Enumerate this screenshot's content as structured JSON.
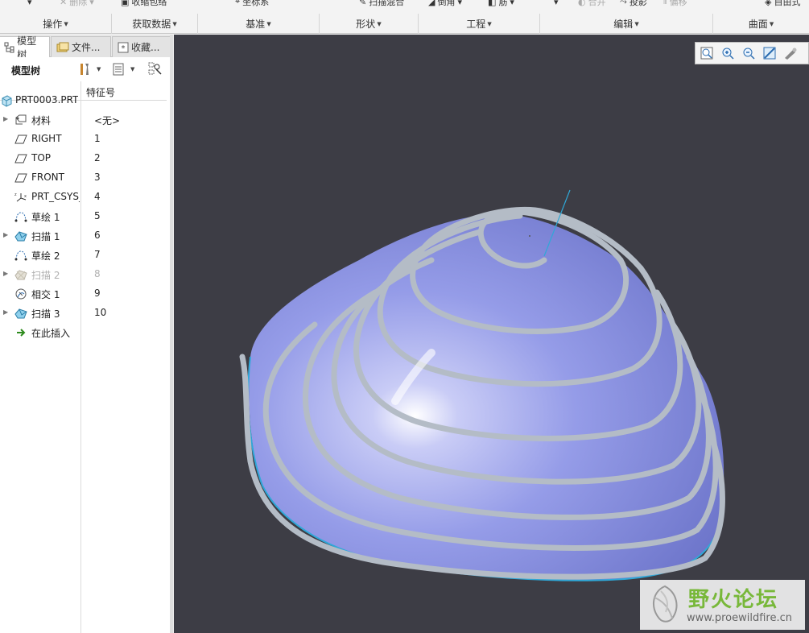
{
  "ribbon": {
    "top_items": [
      {
        "label": "删除",
        "dim": true
      },
      {
        "label": "收缩包络",
        "dim": false
      },
      {
        "label": "坐标系",
        "dim": false
      },
      {
        "label": "扫描混合",
        "dim": false
      },
      {
        "label": "倒角",
        "dim": false
      },
      {
        "label": "筋",
        "dim": false
      },
      {
        "label": "合并",
        "dim": true
      },
      {
        "label": "投影",
        "dim": false
      },
      {
        "label": "偏移",
        "dim": true
      },
      {
        "label": "自由式",
        "dim": false
      }
    ],
    "groups": [
      "操作",
      "获取数据",
      "基准",
      "形状",
      "工程",
      "编辑",
      "曲面"
    ]
  },
  "left_panel": {
    "tabs": [
      {
        "label": "模型树",
        "icon": "model-tree-icon"
      },
      {
        "label": "文件...",
        "icon": "folder-icon"
      },
      {
        "label": "收藏...",
        "icon": "favorites-icon"
      }
    ],
    "tree_title": "模型树",
    "column_header": "特征号",
    "root": "PRT0003.PRT",
    "rows": [
      {
        "label": "材料",
        "featno": "<无>",
        "icon": "material-icon",
        "expandable": true,
        "disabled": false
      },
      {
        "label": "RIGHT",
        "featno": "1",
        "icon": "datum-plane-icon",
        "expandable": false,
        "disabled": false
      },
      {
        "label": "TOP",
        "featno": "2",
        "icon": "datum-plane-icon",
        "expandable": false,
        "disabled": false
      },
      {
        "label": "FRONT",
        "featno": "3",
        "icon": "datum-plane-icon",
        "expandable": false,
        "disabled": false
      },
      {
        "label": "PRT_CSYS_",
        "featno": "4",
        "icon": "csys-icon",
        "expandable": false,
        "disabled": false
      },
      {
        "label": "草绘 1",
        "featno": "5",
        "icon": "sketch-icon",
        "expandable": false,
        "disabled": false
      },
      {
        "label": "扫描 1",
        "featno": "6",
        "icon": "sweep-icon",
        "expandable": true,
        "disabled": false
      },
      {
        "label": "草绘 2",
        "featno": "7",
        "icon": "sketch-icon",
        "expandable": false,
        "disabled": false
      },
      {
        "label": "扫描 2",
        "featno": "8",
        "icon": "sweep-icon",
        "expandable": true,
        "disabled": true
      },
      {
        "label": "相交 1",
        "featno": "9",
        "icon": "intersect-icon",
        "expandable": false,
        "disabled": false
      },
      {
        "label": "扫描 3",
        "featno": "10",
        "icon": "sweep-icon",
        "expandable": true,
        "disabled": false
      },
      {
        "label": "在此插入",
        "featno": "",
        "icon": "insert-arrow-icon",
        "expandable": false,
        "disabled": false
      }
    ]
  },
  "watermark": {
    "title": "野火论坛",
    "url": "www.proewildfire.cn"
  },
  "colors": {
    "viewport_bg": "#3d3d45",
    "model_fill": "#8e95e6",
    "coil": "#b4bcc6",
    "edge": "#2fa8d8"
  }
}
